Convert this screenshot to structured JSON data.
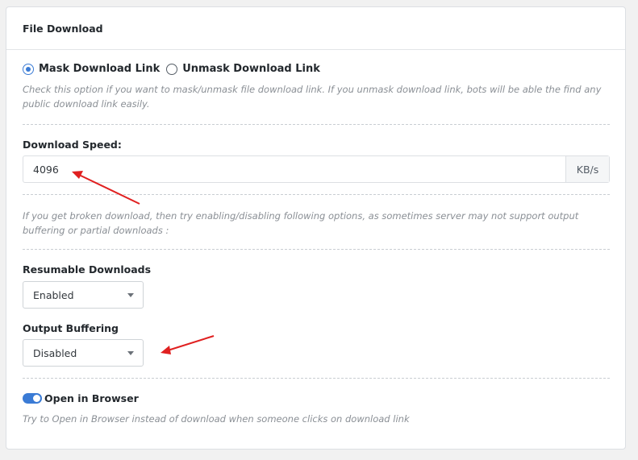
{
  "panel": {
    "title": "File Download"
  },
  "mask": {
    "options": [
      {
        "label": "Mask Download Link",
        "checked": true
      },
      {
        "label": "Unmask Download Link",
        "checked": false
      }
    ],
    "help": "Check this option if you want to mask/unmask file download link. If you unmask download link, bots will be able the find any public download link easily."
  },
  "speed": {
    "label": "Download Speed:",
    "value": "4096",
    "unit": "KB/s"
  },
  "broken_help": "If you get broken download, then try enabling/disabling following options, as sometimes server may not support output buffering or partial downloads :",
  "resumable": {
    "label": "Resumable Downloads",
    "value": "Enabled"
  },
  "buffering": {
    "label": "Output Buffering",
    "value": "Disabled"
  },
  "browser": {
    "label": "Open in Browser",
    "enabled": true,
    "help": "Try to Open in Browser instead of download when someone clicks on download link"
  },
  "colors": {
    "accent": "#3a7bd5",
    "annotation_arrow": "#e02020"
  }
}
